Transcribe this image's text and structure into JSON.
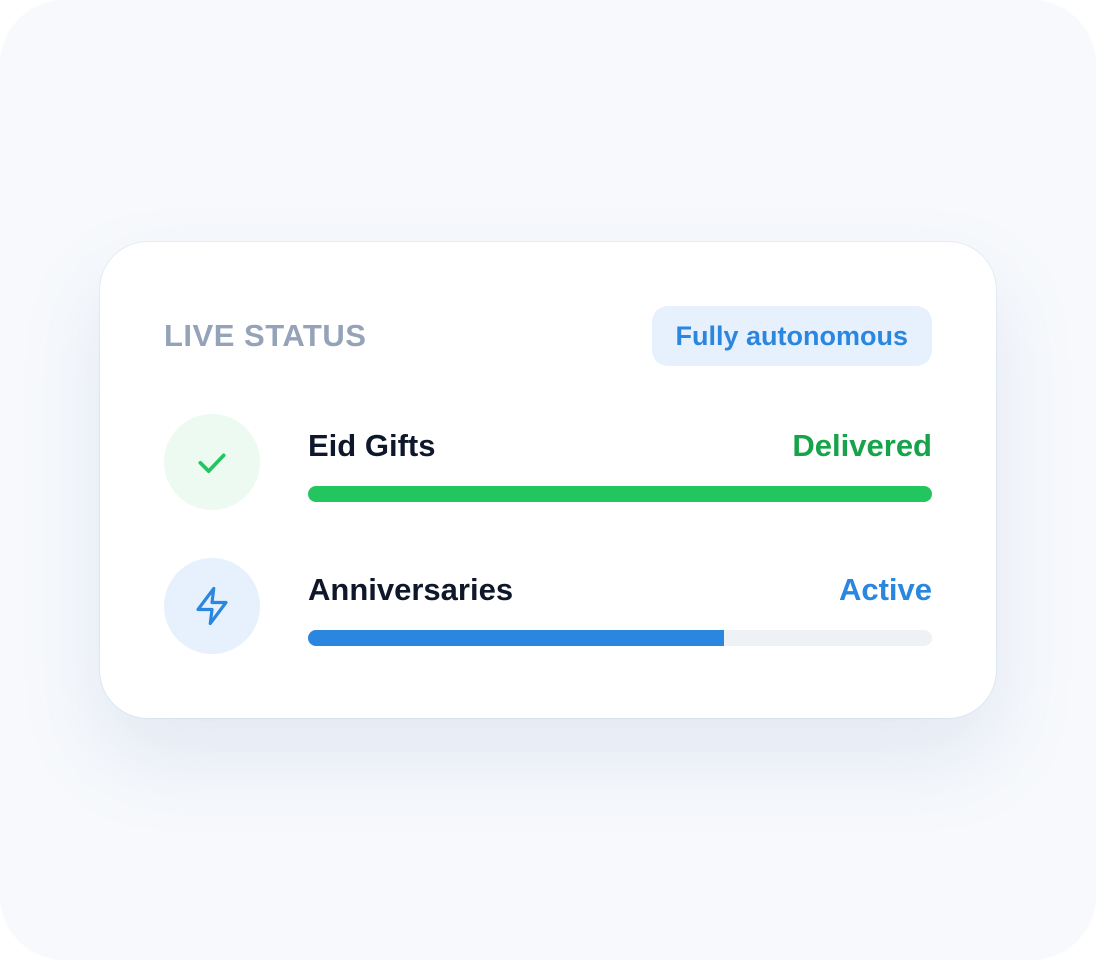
{
  "card": {
    "title": "LIVE STATUS",
    "badge": "Fully autonomous"
  },
  "items": [
    {
      "name": "Eid Gifts",
      "status": "Delivered",
      "progress": 1.0,
      "icon": "check-icon",
      "color": "#22c55e",
      "status_color": "#16a34a"
    },
    {
      "name": "Anniversaries",
      "status": "Active",
      "progress": 0.667,
      "icon": "lightning-bolt-icon",
      "color": "#2b86e0",
      "status_color": "#2b86e0"
    }
  ]
}
